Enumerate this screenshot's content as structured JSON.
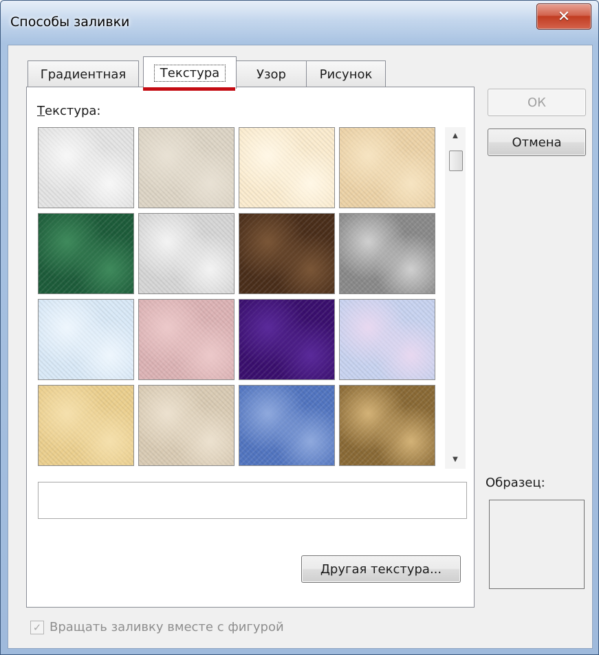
{
  "window": {
    "title": "Способы заливки",
    "close_glyph": "✕"
  },
  "tabs": [
    {
      "label": "Градиентная",
      "active": false
    },
    {
      "label": "Текстура",
      "active": true
    },
    {
      "label": "Узор",
      "active": false
    },
    {
      "label": "Рисунок",
      "active": false
    }
  ],
  "texture_panel": {
    "label_first": "Т",
    "label_rest": "екстура:",
    "selected_name": "",
    "other_button_first": "Д",
    "other_button_rest": "ругая текстура..."
  },
  "textures": [
    {
      "name": "white-marble",
      "color": "#e4e4e4",
      "accent": "#f7f7f7"
    },
    {
      "name": "beige-canvas",
      "color": "#ddd5c6",
      "accent": "#e8e1d4"
    },
    {
      "name": "cream-paper",
      "color": "#fbeccf",
      "accent": "#fff7e6"
    },
    {
      "name": "tan-paper",
      "color": "#ecd2a7",
      "accent": "#f6e4c2"
    },
    {
      "name": "green-marble",
      "color": "#1d5c3a",
      "accent": "#3f8a5c"
    },
    {
      "name": "gray-marble",
      "color": "#d6d6d6",
      "accent": "#f3f3f3"
    },
    {
      "name": "brown-marble",
      "color": "#4a2e1a",
      "accent": "#7a5637"
    },
    {
      "name": "granite",
      "color": "#8a8a8a",
      "accent": "#cfcfcf"
    },
    {
      "name": "light-blue-paper",
      "color": "#d9e9f7",
      "accent": "#eef6fd"
    },
    {
      "name": "pink-paper",
      "color": "#dcb3b5",
      "accent": "#ecc9ca"
    },
    {
      "name": "purple-mesh",
      "color": "#3a0f6e",
      "accent": "#5a2a9a"
    },
    {
      "name": "bouquet",
      "color": "#c8d3f0",
      "accent": "#e8d8f0"
    },
    {
      "name": "papyrus",
      "color": "#ebcf8e",
      "accent": "#f5e0ad"
    },
    {
      "name": "burlap-light",
      "color": "#d9cbb4",
      "accent": "#ece1cf"
    },
    {
      "name": "blue-denim",
      "color": "#5275c0",
      "accent": "#8fa9dd"
    },
    {
      "name": "woven-mat",
      "color": "#8a6a36",
      "accent": "#d3b277"
    }
  ],
  "buttons": {
    "ok": "ОК",
    "cancel": "Отмена"
  },
  "sample": {
    "label": "Образец:"
  },
  "rotate_option": {
    "label": "Вращать заливку вместе с фигурой",
    "checked": true,
    "enabled": false
  },
  "colors": {
    "selected_tab_underline": "#c40b12",
    "close_button": "#c13d22"
  }
}
